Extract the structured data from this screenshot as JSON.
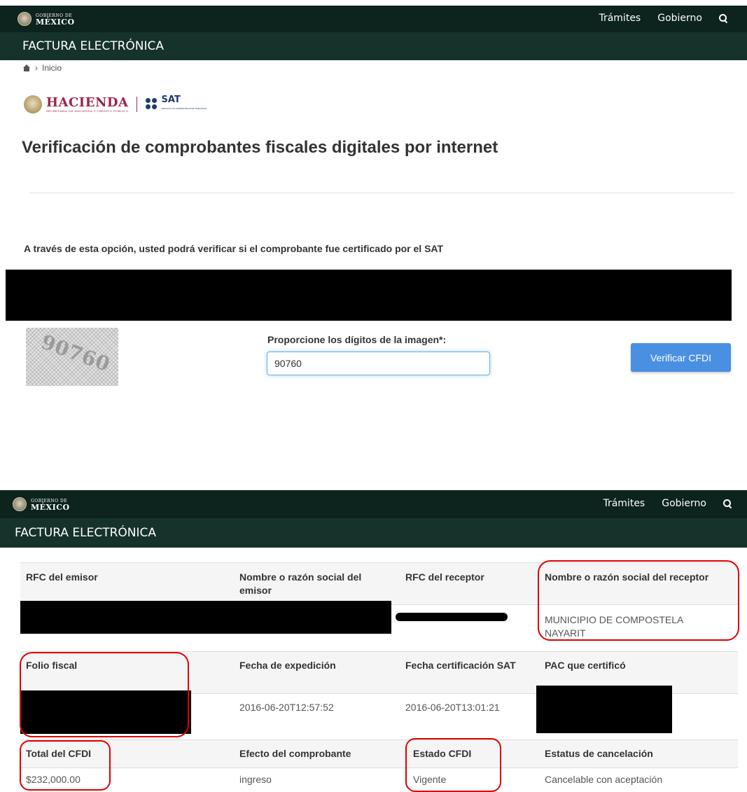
{
  "top": {
    "gob_small": "GOBIERNO DE",
    "gob_big": "MÉXICO",
    "nav": [
      "Trámites",
      "Gobierno"
    ],
    "section_title": "FACTURA ELECTRÓNICA"
  },
  "breadcrumb": {
    "home_label": "Inicio"
  },
  "logos": {
    "hacienda": "HACIENDA",
    "hacienda_sub": "SECRETARÍA DE HACIENDA Y CRÉDITO PÚBLICO",
    "sat": "SAT",
    "sat_sub": "SERVICIO DE ADMINISTRACIÓN TRIBUTARIA"
  },
  "page_title": "Verificación de comprobantes fiscales digitales por internet",
  "intro_text": "A través de esta opción, usted podrá verificar si el comprobante fue certificado por el SAT",
  "captcha": {
    "image_digits": "90760",
    "label": "Proporcione los dígitos de la imagen*:",
    "input_value": "90760",
    "button_label": "Verificar CFDI"
  },
  "bottom": {
    "gob_small": "GOBIERNO DE",
    "gob_big": "MÉXICO",
    "nav": [
      "Trámites",
      "Gobierno"
    ],
    "section_title": "FACTURA ELECTRÓNICA"
  },
  "results": {
    "row1_headers": [
      "RFC del emisor",
      "Nombre o razón social del emisor",
      "RFC del receptor",
      "Nombre o razón social del receptor"
    ],
    "row1_values": [
      "",
      "",
      "",
      "MUNICIPIO DE COMPOSTELA NAYARIT"
    ],
    "row2_headers": [
      "Folio fiscal",
      "Fecha de expedición",
      "Fecha certificación SAT",
      "PAC que certificó"
    ],
    "row2_values": [
      "",
      "2016-06-20T12:57:52",
      "2016-06-20T13:01:21",
      ""
    ],
    "row3_headers": [
      "Total del CFDI",
      "Efecto del comprobante",
      "Estado CFDI",
      "Estatus de cancelación"
    ],
    "row3_values": [
      "$232,000.00",
      "ingreso",
      "Vigente",
      "Cancelable con aceptación"
    ]
  },
  "colors": {
    "gov_bar": "#0c231e",
    "sub_bar": "#15322b",
    "button": "#4a90e2",
    "highlight": "#e00000"
  }
}
